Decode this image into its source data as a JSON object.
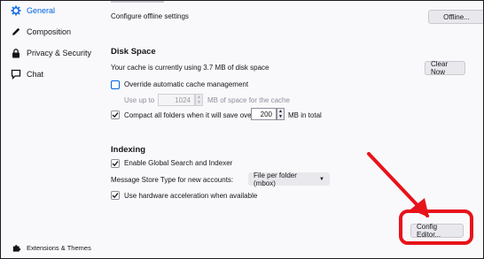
{
  "sidebar": {
    "items": [
      {
        "label": "General",
        "icon": "gear-icon",
        "active": true
      },
      {
        "label": "Composition",
        "icon": "pencil-icon"
      },
      {
        "label": "Privacy & Security",
        "icon": "lock-icon"
      },
      {
        "label": "Chat",
        "icon": "chat-icon"
      }
    ],
    "extensions_label": "Extensions & Themes"
  },
  "offline": {
    "description": "Configure offline settings",
    "button": "Offline..."
  },
  "disk_space": {
    "title": "Disk Space",
    "usage_text": "Your cache is currently using 3.7 MB of disk space",
    "clear_button": "Clear Now",
    "override_label": "Override automatic cache management",
    "override_checked": false,
    "use_up_to_label": "Use up to",
    "cache_size_value": "1024",
    "cache_size_suffix": "MB of space for the cache",
    "compact_label": "Compact all folders when it will save over",
    "compact_checked": true,
    "compact_value": "200",
    "compact_suffix": "MB in total"
  },
  "indexing": {
    "title": "Indexing",
    "global_search_label": "Enable Global Search and Indexer",
    "global_search_checked": true,
    "store_type_label": "Message Store Type for new accounts:",
    "store_type_value": "File per folder (mbox)",
    "hw_accel_label": "Use hardware acceleration when available",
    "hw_accel_checked": true
  },
  "config_editor_button": "Config Editor...",
  "colors": {
    "accent": "#0061e0",
    "annotation": "#e8121a"
  }
}
